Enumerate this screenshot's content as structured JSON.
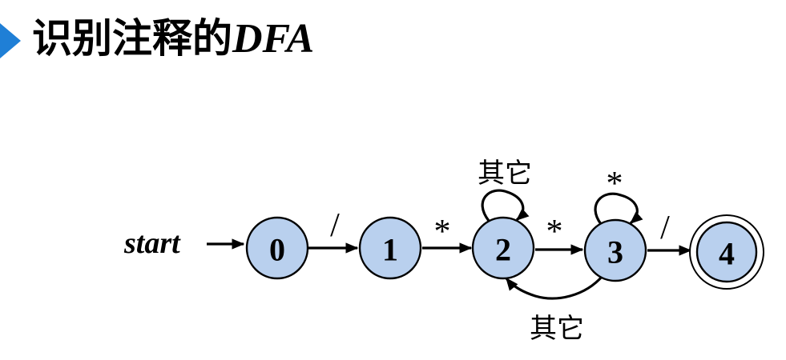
{
  "title": {
    "main": "识别注释的",
    "suffix": "DFA"
  },
  "colors": {
    "title_marker": "#1f7fd6",
    "state_fill": "#b9d0ee"
  },
  "diagram": {
    "start_label": "start",
    "states": [
      {
        "id": "0",
        "label": "0",
        "accepting": false
      },
      {
        "id": "1",
        "label": "1",
        "accepting": false
      },
      {
        "id": "2",
        "label": "2",
        "accepting": false
      },
      {
        "id": "3",
        "label": "3",
        "accepting": false
      },
      {
        "id": "4",
        "label": "4",
        "accepting": true
      }
    ],
    "transitions": [
      {
        "from": "0",
        "to": "1",
        "label": "/"
      },
      {
        "from": "1",
        "to": "2",
        "label": "*"
      },
      {
        "from": "2",
        "to": "2",
        "label": "其它"
      },
      {
        "from": "2",
        "to": "3",
        "label": "*"
      },
      {
        "from": "3",
        "to": "3",
        "label": "*"
      },
      {
        "from": "3",
        "to": "4",
        "label": "/"
      },
      {
        "from": "3",
        "to": "2",
        "label": "其它"
      }
    ]
  }
}
